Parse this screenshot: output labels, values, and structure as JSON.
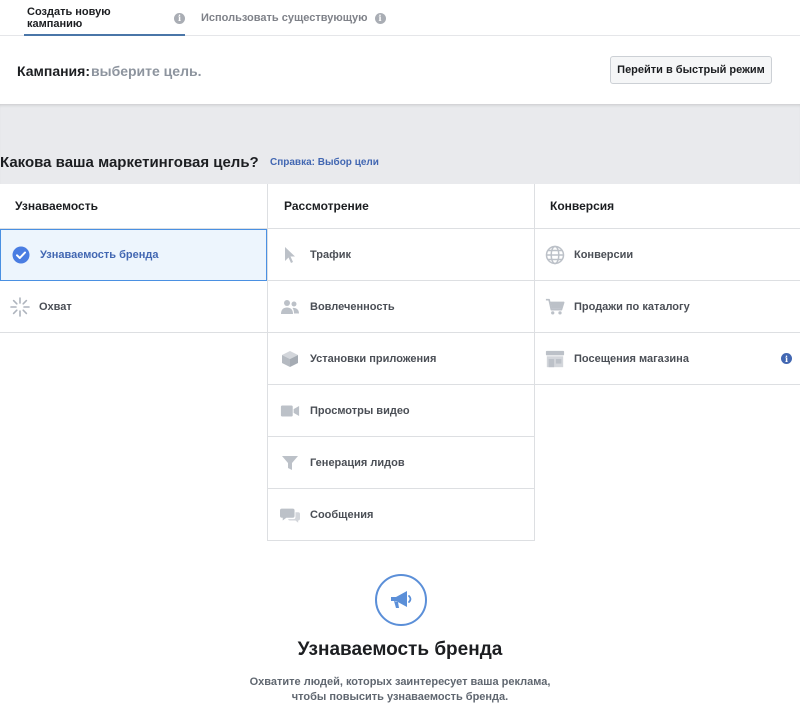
{
  "tabs": [
    {
      "label": "Создать новую кампанию",
      "info": "i"
    },
    {
      "label": "Использовать существующую",
      "info": "i"
    }
  ],
  "campaign": {
    "label": "Кампания:",
    "value": "выберите цель.",
    "quick_mode_button": "Перейти в быстрый режим"
  },
  "objective": {
    "question": "Какова ваша маркетинговая цель?",
    "help_link": "Справка: Выбор цели"
  },
  "columns": [
    {
      "header": "Узнаваемость",
      "items": [
        {
          "label": "Узнаваемость бренда",
          "icon": "check-circle-icon",
          "selected": true
        },
        {
          "label": "Охват",
          "icon": "reach-burst-icon"
        }
      ]
    },
    {
      "header": "Рассмотрение",
      "items": [
        {
          "label": "Трафик",
          "icon": "cursor-icon"
        },
        {
          "label": "Вовлеченность",
          "icon": "people-icon"
        },
        {
          "label": "Установки приложения",
          "icon": "box-icon"
        },
        {
          "label": "Просмотры видео",
          "icon": "video-camera-icon"
        },
        {
          "label": "Генерация лидов",
          "icon": "funnel-icon"
        },
        {
          "label": "Сообщения",
          "icon": "chat-bubbles-icon"
        }
      ]
    },
    {
      "header": "Конверсия",
      "items": [
        {
          "label": "Конверсии",
          "icon": "globe-icon"
        },
        {
          "label": "Продажи по каталогу",
          "icon": "shopping-cart-icon"
        },
        {
          "label": "Посещения магазина",
          "icon": "store-icon",
          "info": "i"
        }
      ]
    }
  ],
  "detail": {
    "icon": "megaphone-icon",
    "title": "Узнаваемость бренда",
    "description_line1": "Охватите людей, которых заинтересует ваша реклама,",
    "description_line2": "чтобы повысить узнаваемость бренда."
  },
  "colors": {
    "accent": "#4267b2",
    "selected_bg": "#edf5fd",
    "selected_border": "#4a90e2",
    "band": "#e9eaed",
    "icon_gray": "#bec3c9"
  }
}
